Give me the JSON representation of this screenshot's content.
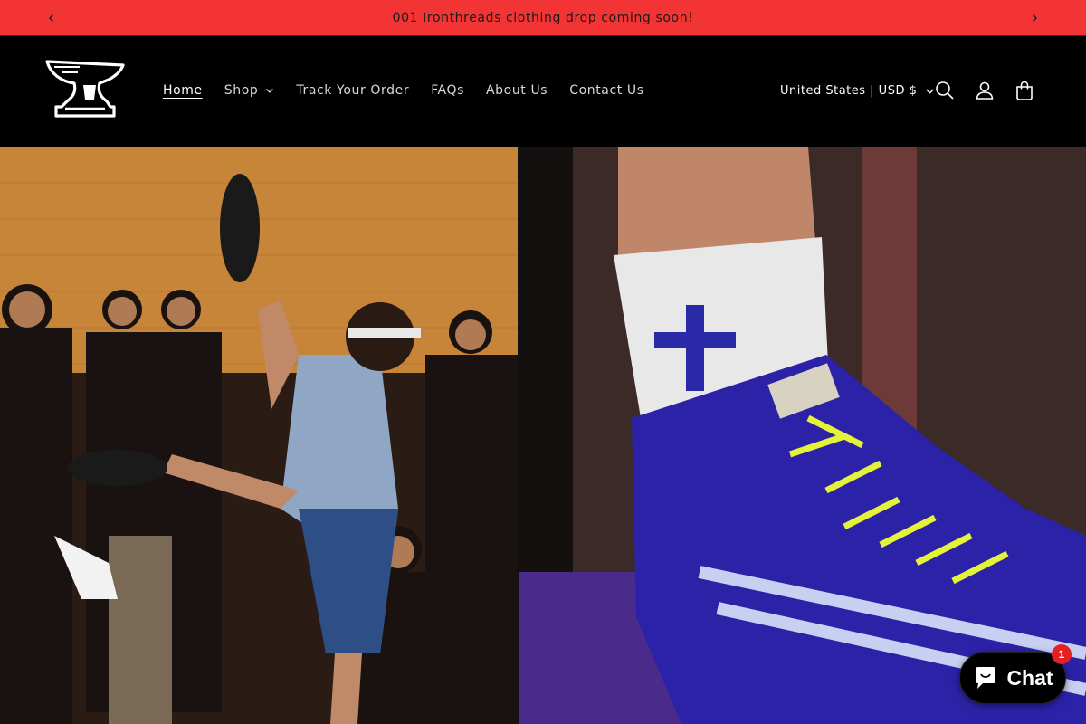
{
  "announcement": {
    "text": "001 Ironthreads clothing drop coming soon!",
    "background_color": "#f23534",
    "prev_icon": "chevron-left-icon",
    "next_icon": "chevron-right-icon"
  },
  "header": {
    "logo_icon": "anvil-logo-icon",
    "nav": [
      {
        "label": "Home",
        "active": true
      },
      {
        "label": "Shop",
        "has_dropdown": true
      },
      {
        "label": "Track Your Order"
      },
      {
        "label": "FAQs"
      },
      {
        "label": "About Us"
      },
      {
        "label": "Contact Us"
      }
    ],
    "currency_selector": "United States | USD $",
    "icons": [
      "search-icon",
      "account-icon",
      "cart-icon"
    ]
  },
  "hero": {
    "left_image": "wrestler-kicking-photo",
    "right_image": "wrestling-shoe-closeup-photo"
  },
  "chat": {
    "label": "Chat",
    "badge_count": "1",
    "badge_color": "#e22120"
  }
}
